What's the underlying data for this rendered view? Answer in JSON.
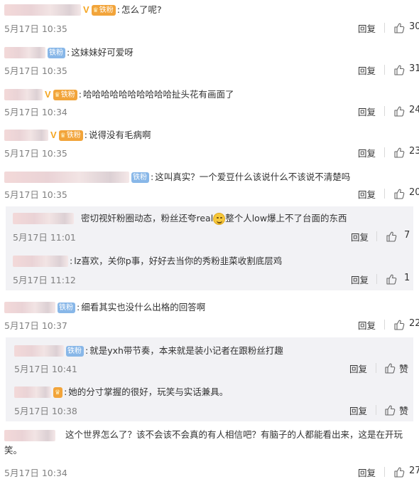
{
  "actions": {
    "reply_label": "回复",
    "like_label": "赞"
  },
  "badges": {
    "fan_label": "铁粉",
    "verified_mark": "V"
  },
  "colors": {
    "fan_gold": "#f2a43a",
    "fan_blue": "#88b7e8",
    "verified": "#f5a623",
    "subreply_bg": "#f2f2f5"
  },
  "comments": [
    {
      "text": "怎么了呢?",
      "time": "5月17日 10:35",
      "likes": "30"
    },
    {
      "text": "这妹妹好可爱呀",
      "time": "5月17日 10:35",
      "likes": "31"
    },
    {
      "text": "哈哈哈哈哈哈哈哈哈哈扯头花有画面了",
      "time": "5月17日 10:34",
      "likes": "24"
    },
    {
      "text": "说得没有毛病啊",
      "time": "5月17日 10:35",
      "likes": "23"
    },
    {
      "text": "这叫真实？一个爱豆什么该说什么不该说不清楚吗",
      "time": "5月17日 10:35",
      "likes": "20"
    },
    {
      "text": "细看其实也没什么出格的回答啊",
      "time": "5月17日 10:37",
      "likes": "22"
    },
    {
      "text": "这个世界怎么了？该不会该不会真的有人相信吧？有脑子的人都能看出来，这是在开玩笑。",
      "time": "5月17日 10:34",
      "likes": "27"
    }
  ],
  "replies": [
    {
      "text_a": "密切视奸粉圈动态，粉丝还夸real",
      "text_b": "整个人low爆上不了台面的东西",
      "emoji": "grinning-sweat-emoji",
      "time": "5月17日 11:01",
      "likes": "7"
    },
    {
      "text": "lz喜欢，关你p事，好好去当你的秀粉韭菜收割底层鸡",
      "time": "5月17日 11:12",
      "likes": "1"
    },
    {
      "text": "就是yxh带节奏，本来就是装小记者在跟粉丝打趣",
      "time": "5月17日 10:41"
    },
    {
      "text": "她的分寸掌握的很好，玩笑与实话兼具。",
      "time": "5月17日 10:38"
    }
  ]
}
